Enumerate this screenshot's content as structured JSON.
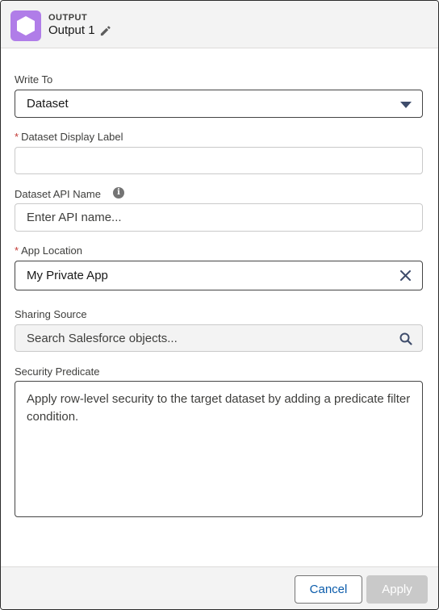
{
  "header": {
    "kicker": "OUTPUT",
    "title": "Output 1",
    "node_icon": "hexagon-icon",
    "edit_icon": "pencil-icon",
    "accent_color": "#b07de8"
  },
  "form": {
    "write_to": {
      "label": "Write To",
      "value": "Dataset"
    },
    "display_label": {
      "label": "Dataset Display Label",
      "required": "*",
      "value": ""
    },
    "api_name": {
      "label": "Dataset API Name",
      "placeholder": "Enter API name...",
      "info_icon": "info-icon"
    },
    "app_location": {
      "label": "App Location",
      "required": "*",
      "value": "My Private App",
      "clear_icon": "close-icon"
    },
    "sharing_source": {
      "label": "Sharing Source",
      "placeholder": "Search Salesforce objects...",
      "search_icon": "search-icon"
    },
    "security_predicate": {
      "label": "Security Predicate",
      "placeholder": "Apply row-level security to the target dataset by adding a predicate filter condition."
    }
  },
  "footer": {
    "cancel_label": "Cancel",
    "apply_label": "Apply"
  }
}
